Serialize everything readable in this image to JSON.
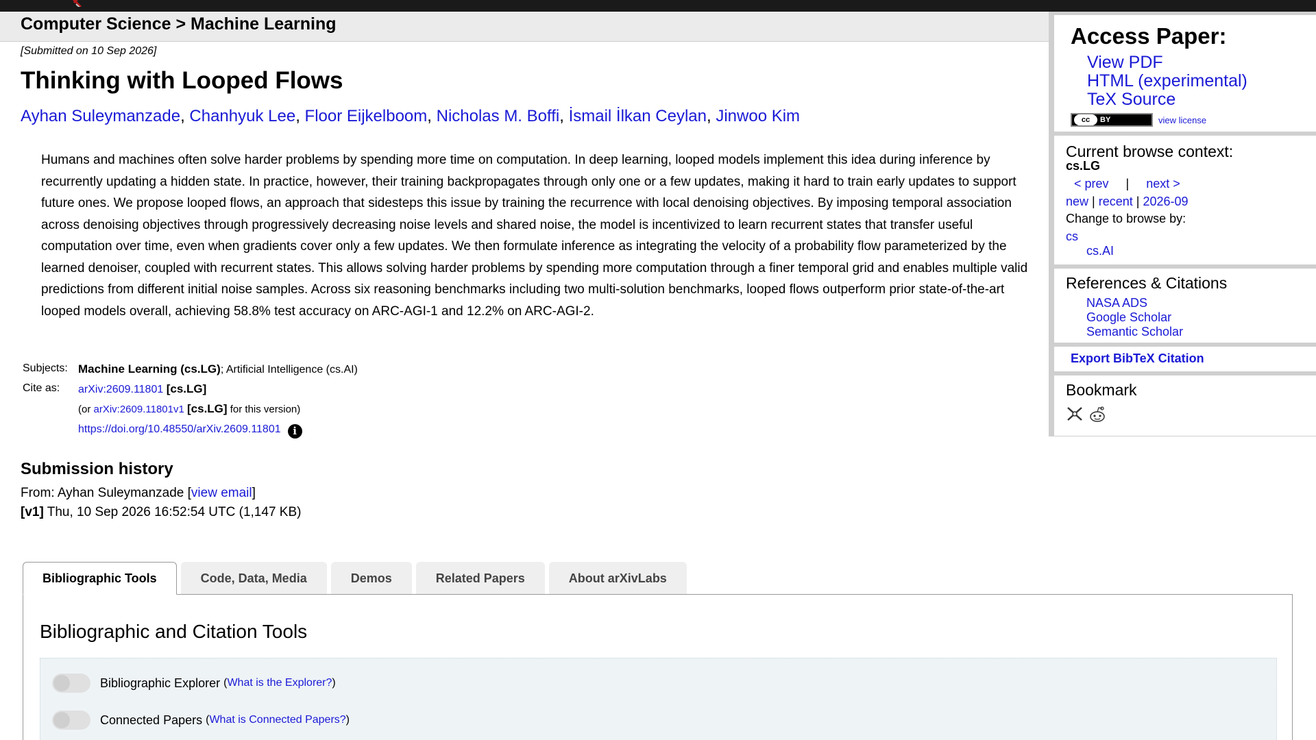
{
  "breadcrumb": "Computer Science > Machine Learning",
  "paper": {
    "submitted": "[Submitted on 10 Sep 2026]",
    "title": "Thinking with Looped Flows",
    "authors": [
      "Ayhan Suleymanzade",
      "Chanhyuk Lee",
      "Floor Eijkelboom",
      "Nicholas M. Boffi",
      "İsmail İlkan Ceylan",
      "Jinwoo Kim"
    ],
    "abstract": "Humans and machines often solve harder problems by spending more time on computation. In deep learning, looped models implement this idea during inference by recurrently updating a hidden state. In practice, however, their training backpropagates through only one or a few updates, making it hard to train early updates to support future ones. We propose looped flows, an approach that sidesteps this issue by training the recurrence with local denoising objectives. By imposing temporal association across denoising objectives through progressively decreasing noise levels and shared noise, the model is incentivized to learn recurrent states that transfer useful computation over time, even when gradients cover only a few updates. We then formulate inference as integrating the velocity of a probability flow parameterized by the learned denoiser, coupled with recurrent states. This allows solving harder problems by spending more computation through a finer temporal grid and enables multiple valid predictions from different initial noise samples. Across six reasoning benchmarks including two multi-solution benchmarks, looped flows outperform prior state-of-the-art looped models overall, achieving 58.8% test accuracy on ARC-AGI-1 and 12.2% on ARC-AGI-2."
  },
  "meta": {
    "subjects_label": "Subjects:",
    "subjects_primary": "Machine Learning (cs.LG)",
    "subjects_rest": "; Artificial Intelligence (cs.AI)",
    "cite_label": "Cite as:",
    "cite_id": "arXiv:2609.11801",
    "cite_cat": "[cs.LG]",
    "or_prefix": "(or ",
    "or_id": "arXiv:2609.11801v1",
    "or_cat": "[cs.LG]",
    "or_suffix": " for this version)",
    "doi": "https://doi.org/10.48550/arXiv.2609.11801",
    "info": "i"
  },
  "history": {
    "heading": "Submission history",
    "from_prefix": "From: Ayhan Suleymanzade [",
    "view_email": "view email",
    "from_suffix": "]",
    "version_tag": "[v1]",
    "version_text": " Thu, 10 Sep 2026 16:52:54 UTC (1,147 KB)"
  },
  "tabs": [
    "Bibliographic Tools",
    "Code, Data, Media",
    "Demos",
    "Related Papers",
    "About arXivLabs"
  ],
  "panel": {
    "heading": "Bibliographic and Citation Tools",
    "tools": [
      {
        "label": "Bibliographic Explorer",
        "link": "What is the Explorer?"
      },
      {
        "label": "Connected Papers",
        "link": "What is Connected Papers?"
      }
    ]
  },
  "sidebar": {
    "access_heading": "Access Paper:",
    "access_links": [
      "View PDF",
      "HTML (experimental)",
      "TeX Source"
    ],
    "license_cc": "cc",
    "license_by": "BY",
    "view_license": "view license",
    "browse_heading": "Current browse context:",
    "browse_context": "cs.LG",
    "prev": "< prev",
    "sep": "|",
    "next": "next >",
    "new": "new",
    "recent": "recent",
    "month": "2026-09",
    "change_to": "Change to browse by:",
    "cs": "cs",
    "cs_ai": "cs.AI",
    "refs_heading": "References & Citations",
    "refs_links": [
      "NASA ADS",
      "Google Scholar",
      "Semantic Scholar"
    ],
    "export_bibtex": "Export BibTeX Citation",
    "bookmark_heading": "Bookmark"
  },
  "colors": {
    "link": "#1a1ad6",
    "topbar": "#1a1a1a",
    "logo_red": "#b31b1b"
  }
}
